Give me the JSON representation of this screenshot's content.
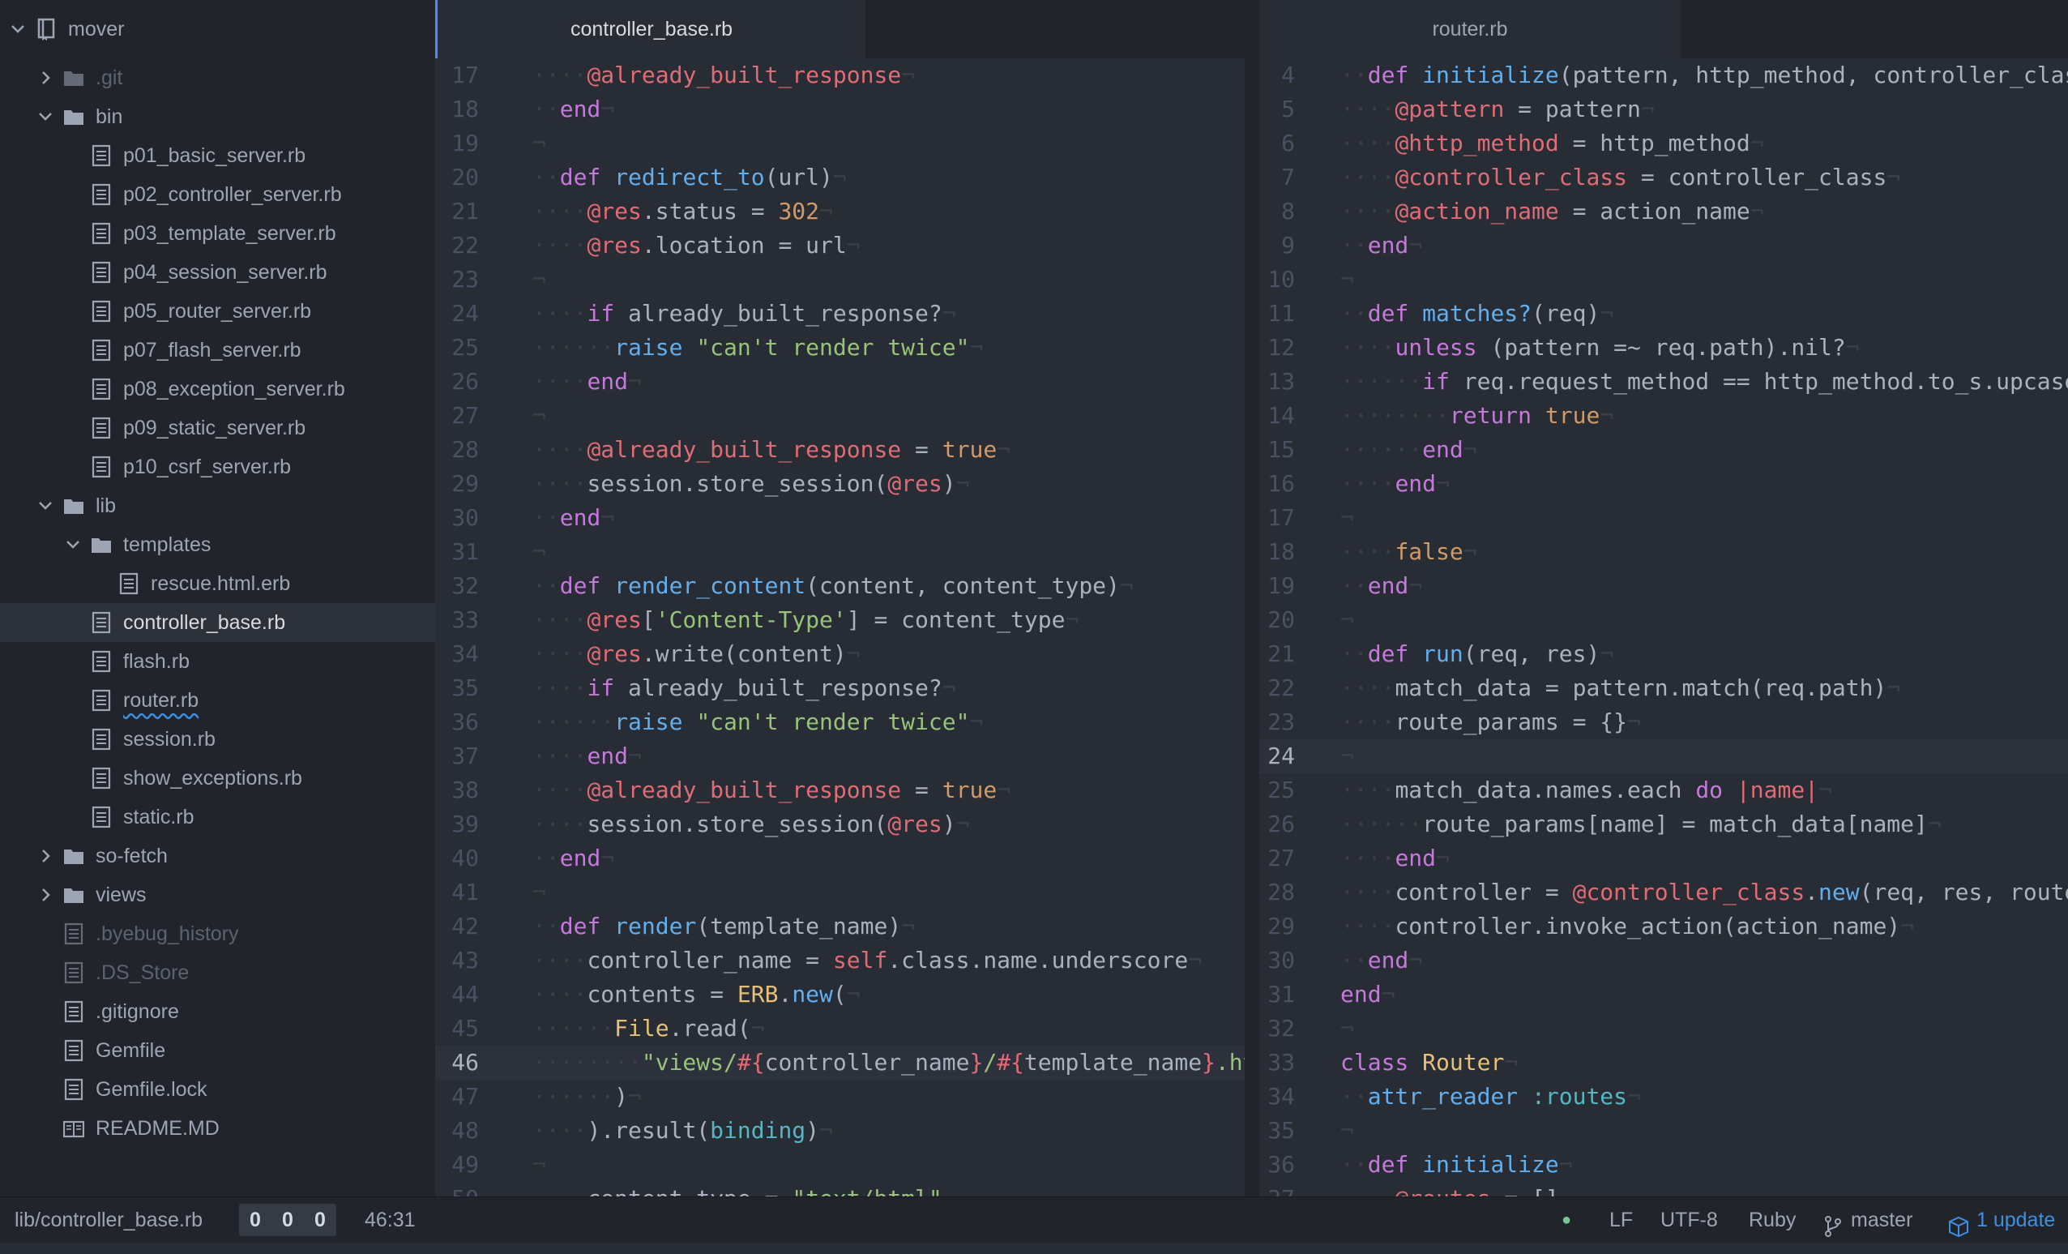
{
  "sidebar": {
    "project": "mover",
    "items": [
      {
        "label": ".git",
        "type": "folder",
        "depth": 1,
        "expanded": false,
        "ignored": true
      },
      {
        "label": "bin",
        "type": "folder",
        "depth": 1,
        "expanded": true
      },
      {
        "label": "p01_basic_server.rb",
        "type": "file",
        "depth": 2
      },
      {
        "label": "p02_controller_server.rb",
        "type": "file",
        "depth": 2
      },
      {
        "label": "p03_template_server.rb",
        "type": "file",
        "depth": 2
      },
      {
        "label": "p04_session_server.rb",
        "type": "file",
        "depth": 2
      },
      {
        "label": "p05_router_server.rb",
        "type": "file",
        "depth": 2
      },
      {
        "label": "p07_flash_server.rb",
        "type": "file",
        "depth": 2
      },
      {
        "label": "p08_exception_server.rb",
        "type": "file",
        "depth": 2
      },
      {
        "label": "p09_static_server.rb",
        "type": "file",
        "depth": 2
      },
      {
        "label": "p10_csrf_server.rb",
        "type": "file",
        "depth": 2
      },
      {
        "label": "lib",
        "type": "folder",
        "depth": 1,
        "expanded": true
      },
      {
        "label": "templates",
        "type": "folder",
        "depth": 2,
        "expanded": true
      },
      {
        "label": "rescue.html.erb",
        "type": "file",
        "depth": 3
      },
      {
        "label": "controller_base.rb",
        "type": "file",
        "depth": 2,
        "selected": true
      },
      {
        "label": "flash.rb",
        "type": "file",
        "depth": 2
      },
      {
        "label": "router.rb",
        "type": "file",
        "depth": 2,
        "underlined": true
      },
      {
        "label": "session.rb",
        "type": "file",
        "depth": 2
      },
      {
        "label": "show_exceptions.rb",
        "type": "file",
        "depth": 2
      },
      {
        "label": "static.rb",
        "type": "file",
        "depth": 2
      },
      {
        "label": "so-fetch",
        "type": "folder",
        "depth": 1,
        "expanded": false
      },
      {
        "label": "views",
        "type": "folder",
        "depth": 1,
        "expanded": false
      },
      {
        "label": ".byebug_history",
        "type": "file",
        "depth": 1,
        "ignored": true
      },
      {
        "label": ".DS_Store",
        "type": "file",
        "depth": 1,
        "ignored": true
      },
      {
        "label": ".gitignore",
        "type": "file",
        "depth": 1
      },
      {
        "label": "Gemfile",
        "type": "file",
        "depth": 1
      },
      {
        "label": "Gemfile.lock",
        "type": "file",
        "depth": 1
      },
      {
        "label": "README.MD",
        "type": "book",
        "depth": 1
      }
    ]
  },
  "left_pane": {
    "tab": "controller_base.rb",
    "cursor_line": 46,
    "lines": [
      {
        "n": "17",
        "indent": 2,
        "tokens": [
          [
            "iv",
            "@already_built_response"
          ]
        ]
      },
      {
        "n": "18",
        "indent": 1,
        "tokens": [
          [
            "kw",
            "end"
          ]
        ]
      },
      {
        "n": "19",
        "indent": 0,
        "tokens": []
      },
      {
        "n": "20",
        "indent": 1,
        "tokens": [
          [
            "kw",
            "def "
          ],
          [
            "fn",
            "redirect_to"
          ],
          [
            "p",
            "(url)"
          ]
        ]
      },
      {
        "n": "21",
        "indent": 2,
        "tokens": [
          [
            "iv",
            "@res"
          ],
          [
            "p",
            ".status = "
          ],
          [
            "num",
            "302"
          ]
        ]
      },
      {
        "n": "22",
        "indent": 2,
        "tokens": [
          [
            "iv",
            "@res"
          ],
          [
            "p",
            ".location = url"
          ]
        ]
      },
      {
        "n": "23",
        "indent": 0,
        "tokens": []
      },
      {
        "n": "24",
        "indent": 2,
        "tokens": [
          [
            "kw",
            "if "
          ],
          [
            "p",
            "already_built_response?"
          ]
        ]
      },
      {
        "n": "25",
        "indent": 3,
        "tokens": [
          [
            "fn",
            "raise "
          ],
          [
            "str",
            "\"can't render twice\""
          ]
        ]
      },
      {
        "n": "26",
        "indent": 2,
        "tokens": [
          [
            "kw",
            "end"
          ]
        ]
      },
      {
        "n": "27",
        "indent": 0,
        "tokens": []
      },
      {
        "n": "28",
        "indent": 2,
        "tokens": [
          [
            "iv",
            "@already_built_response"
          ],
          [
            "p",
            " = "
          ],
          [
            "num",
            "true"
          ]
        ]
      },
      {
        "n": "29",
        "indent": 2,
        "tokens": [
          [
            "p",
            "session.store_session("
          ],
          [
            "iv",
            "@res"
          ],
          [
            "p",
            ")"
          ]
        ]
      },
      {
        "n": "30",
        "indent": 1,
        "tokens": [
          [
            "kw",
            "end"
          ]
        ]
      },
      {
        "n": "31",
        "indent": 0,
        "tokens": []
      },
      {
        "n": "32",
        "indent": 1,
        "tokens": [
          [
            "kw",
            "def "
          ],
          [
            "fn",
            "render_content"
          ],
          [
            "p",
            "(content, content_type)"
          ]
        ]
      },
      {
        "n": "33",
        "indent": 2,
        "tokens": [
          [
            "iv",
            "@res"
          ],
          [
            "p",
            "["
          ],
          [
            "str",
            "'Content-Type'"
          ],
          [
            "p",
            "] = content_type"
          ]
        ]
      },
      {
        "n": "34",
        "indent": 2,
        "tokens": [
          [
            "iv",
            "@res"
          ],
          [
            "p",
            ".write(content)"
          ]
        ]
      },
      {
        "n": "35",
        "indent": 2,
        "tokens": [
          [
            "kw",
            "if "
          ],
          [
            "p",
            "already_built_response?"
          ]
        ]
      },
      {
        "n": "36",
        "indent": 3,
        "tokens": [
          [
            "fn",
            "raise "
          ],
          [
            "str",
            "\"can't render twice\""
          ]
        ]
      },
      {
        "n": "37",
        "indent": 2,
        "tokens": [
          [
            "kw",
            "end"
          ]
        ]
      },
      {
        "n": "38",
        "indent": 2,
        "tokens": [
          [
            "iv",
            "@already_built_response"
          ],
          [
            "p",
            " = "
          ],
          [
            "num",
            "true"
          ]
        ]
      },
      {
        "n": "39",
        "indent": 2,
        "tokens": [
          [
            "p",
            "session.store_session("
          ],
          [
            "iv",
            "@res"
          ],
          [
            "p",
            ")"
          ]
        ]
      },
      {
        "n": "40",
        "indent": 1,
        "tokens": [
          [
            "kw",
            "end"
          ]
        ]
      },
      {
        "n": "41",
        "indent": 0,
        "tokens": []
      },
      {
        "n": "42",
        "indent": 1,
        "tokens": [
          [
            "kw",
            "def "
          ],
          [
            "fn",
            "render"
          ],
          [
            "p",
            "(template_name)"
          ]
        ]
      },
      {
        "n": "43",
        "indent": 2,
        "tokens": [
          [
            "p",
            "controller_name = "
          ],
          [
            "iv",
            "self"
          ],
          [
            "p",
            ".class.name.underscore"
          ]
        ]
      },
      {
        "n": "44",
        "indent": 2,
        "tokens": [
          [
            "p",
            "contents = "
          ],
          [
            "cls",
            "ERB"
          ],
          [
            "p",
            "."
          ],
          [
            "fn",
            "new"
          ],
          [
            "p",
            "("
          ]
        ]
      },
      {
        "n": "45",
        "indent": 3,
        "tokens": [
          [
            "cls",
            "File"
          ],
          [
            "p",
            ".read("
          ]
        ]
      },
      {
        "n": "46",
        "indent": 4,
        "tokens": [
          [
            "str",
            "\"views/"
          ],
          [
            "iv",
            "#{"
          ],
          [
            "p",
            "controller_name"
          ],
          [
            "iv",
            "}"
          ],
          [
            "str",
            "/"
          ],
          [
            "iv",
            "#{"
          ],
          [
            "p",
            "template_name"
          ],
          [
            "iv",
            "}"
          ],
          [
            "str",
            ".html.erb\""
          ]
        ]
      },
      {
        "n": "47",
        "indent": 3,
        "tokens": [
          [
            "p",
            ")"
          ]
        ]
      },
      {
        "n": "48",
        "indent": 2,
        "tokens": [
          [
            "p",
            ").result("
          ],
          [
            "sym",
            "binding"
          ],
          [
            "p",
            ")"
          ]
        ]
      },
      {
        "n": "49",
        "indent": 0,
        "tokens": []
      },
      {
        "n": "50",
        "indent": 2,
        "tokens": [
          [
            "p",
            "content_type = "
          ],
          [
            "str",
            "\"text/html\""
          ]
        ]
      }
    ]
  },
  "right_pane": {
    "tab": "router.rb",
    "cursor_line": 24,
    "lines": [
      {
        "n": "4",
        "indent": 1,
        "tokens": [
          [
            "kw",
            "def "
          ],
          [
            "fn",
            "initialize"
          ],
          [
            "p",
            "(pattern, http_method, controller_class, action_name)"
          ]
        ]
      },
      {
        "n": "5",
        "indent": 2,
        "tokens": [
          [
            "iv",
            "@pattern"
          ],
          [
            "p",
            " = pattern"
          ]
        ]
      },
      {
        "n": "6",
        "indent": 2,
        "tokens": [
          [
            "iv",
            "@http_method"
          ],
          [
            "p",
            " = http_method"
          ]
        ]
      },
      {
        "n": "7",
        "indent": 2,
        "tokens": [
          [
            "iv",
            "@controller_class"
          ],
          [
            "p",
            " = controller_class"
          ]
        ]
      },
      {
        "n": "8",
        "indent": 2,
        "tokens": [
          [
            "iv",
            "@action_name"
          ],
          [
            "p",
            " = action_name"
          ]
        ]
      },
      {
        "n": "9",
        "indent": 1,
        "tokens": [
          [
            "kw",
            "end"
          ]
        ]
      },
      {
        "n": "10",
        "indent": 0,
        "tokens": []
      },
      {
        "n": "11",
        "indent": 1,
        "tokens": [
          [
            "kw",
            "def "
          ],
          [
            "fn",
            "matches?"
          ],
          [
            "p",
            "(req)"
          ]
        ]
      },
      {
        "n": "12",
        "indent": 2,
        "tokens": [
          [
            "kw",
            "unless "
          ],
          [
            "p",
            "(pattern =~ req.path).nil?"
          ]
        ]
      },
      {
        "n": "13",
        "indent": 3,
        "tokens": [
          [
            "kw",
            "if "
          ],
          [
            "p",
            "req.request_method == http_method.to_s.upcase"
          ]
        ]
      },
      {
        "n": "14",
        "indent": 4,
        "tokens": [
          [
            "kw",
            "return "
          ],
          [
            "num",
            "true"
          ]
        ]
      },
      {
        "n": "15",
        "indent": 3,
        "tokens": [
          [
            "kw",
            "end"
          ]
        ]
      },
      {
        "n": "16",
        "indent": 2,
        "tokens": [
          [
            "kw",
            "end"
          ]
        ]
      },
      {
        "n": "17",
        "indent": 0,
        "tokens": []
      },
      {
        "n": "18",
        "indent": 2,
        "tokens": [
          [
            "num",
            "false"
          ]
        ]
      },
      {
        "n": "19",
        "indent": 1,
        "tokens": [
          [
            "kw",
            "end"
          ]
        ]
      },
      {
        "n": "20",
        "indent": 0,
        "tokens": []
      },
      {
        "n": "21",
        "indent": 1,
        "tokens": [
          [
            "kw",
            "def "
          ],
          [
            "fn",
            "run"
          ],
          [
            "p",
            "(req, res)"
          ]
        ]
      },
      {
        "n": "22",
        "indent": 2,
        "tokens": [
          [
            "p",
            "match_data = pattern.match(req.path)"
          ]
        ]
      },
      {
        "n": "23",
        "indent": 2,
        "tokens": [
          [
            "p",
            "route_params = {}"
          ]
        ]
      },
      {
        "n": "24",
        "indent": 0,
        "tokens": []
      },
      {
        "n": "25",
        "indent": 2,
        "tokens": [
          [
            "p",
            "match_data.names.each "
          ],
          [
            "kw",
            "do "
          ],
          [
            "iv",
            "|name|"
          ]
        ]
      },
      {
        "n": "26",
        "indent": 3,
        "tokens": [
          [
            "p",
            "route_params[name] = match_data[name]"
          ]
        ]
      },
      {
        "n": "27",
        "indent": 2,
        "tokens": [
          [
            "kw",
            "end"
          ]
        ]
      },
      {
        "n": "28",
        "indent": 2,
        "tokens": [
          [
            "p",
            "controller = "
          ],
          [
            "iv",
            "@controller_class"
          ],
          [
            "p",
            "."
          ],
          [
            "fn",
            "new"
          ],
          [
            "p",
            "(req, res, route_params)"
          ]
        ]
      },
      {
        "n": "29",
        "indent": 2,
        "tokens": [
          [
            "p",
            "controller.invoke_action(action_name)"
          ]
        ]
      },
      {
        "n": "30",
        "indent": 1,
        "tokens": [
          [
            "kw",
            "end"
          ]
        ]
      },
      {
        "n": "31",
        "indent": 0,
        "tokens": [
          [
            "kw",
            "end"
          ]
        ]
      },
      {
        "n": "32",
        "indent": 0,
        "tokens": []
      },
      {
        "n": "33",
        "indent": 0,
        "tokens": [
          [
            "kw",
            "class "
          ],
          [
            "cls",
            "Router"
          ]
        ]
      },
      {
        "n": "34",
        "indent": 1,
        "tokens": [
          [
            "fn",
            "attr_reader "
          ],
          [
            "sym",
            ":routes"
          ]
        ]
      },
      {
        "n": "35",
        "indent": 0,
        "tokens": []
      },
      {
        "n": "36",
        "indent": 1,
        "tokens": [
          [
            "kw",
            "def "
          ],
          [
            "fn",
            "initialize"
          ]
        ]
      },
      {
        "n": "37",
        "indent": 2,
        "tokens": [
          [
            "iv",
            "@routes"
          ],
          [
            "p",
            " = []"
          ]
        ]
      }
    ]
  },
  "status": {
    "file_path": "lib/controller_base.rb",
    "counts": [
      "0",
      "0",
      "0"
    ],
    "cursor_pos": "46:31",
    "line_ending": "LF",
    "encoding": "UTF-8",
    "grammar": "Ruby",
    "branch": "master",
    "updates": "1 update",
    "git_dot_color": "#73c990"
  }
}
